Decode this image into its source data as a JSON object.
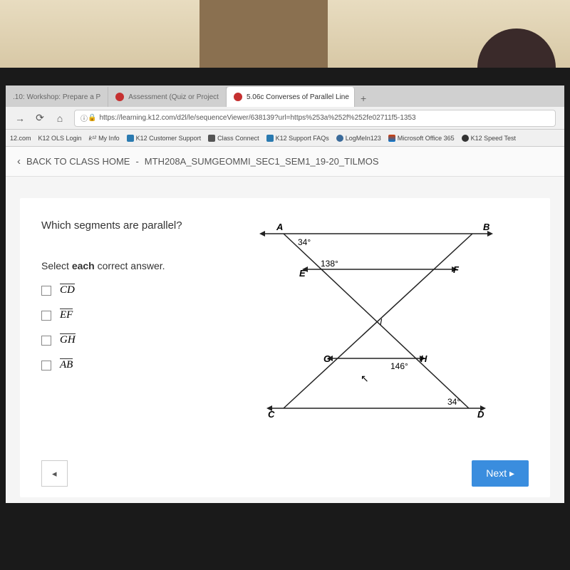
{
  "tabs": [
    {
      "label": ".10: Workshop: Prepare a P",
      "active": false
    },
    {
      "label": "Assessment (Quiz or Project",
      "active": false
    },
    {
      "label": "5.06c Converses of Parallel Line",
      "active": true
    }
  ],
  "url": "https://learning.k12.com/d2l/le/sequenceViewer/638139?url=https%253a%252f%252fe02711f5-1353",
  "bookmarks": [
    {
      "label": "12.com"
    },
    {
      "label": "K12 OLS Login"
    },
    {
      "label": "My Info"
    },
    {
      "label": "K12 Customer Support"
    },
    {
      "label": "Class Connect"
    },
    {
      "label": "K12 Support FAQs"
    },
    {
      "label": "LogMeIn123"
    },
    {
      "label": "Microsoft Office 365"
    },
    {
      "label": "K12 Speed Test"
    }
  ],
  "breadcrumb": {
    "back": "BACK TO CLASS HOME",
    "sep": "-",
    "course": "MTH208A_SUMGEOMMI_SEC1_SEM1_19-20_TILMOS"
  },
  "quiz": {
    "question": "Which segments are parallel?",
    "instruction_prefix": "Select ",
    "instruction_bold": "each",
    "instruction_suffix": " correct answer.",
    "answers": [
      {
        "label": "CD"
      },
      {
        "label": "EF"
      },
      {
        "label": "GH"
      },
      {
        "label": "AB"
      }
    ],
    "diagram": {
      "points": {
        "A": "A",
        "B": "B",
        "C": "C",
        "D": "D",
        "E": "E",
        "F": "F",
        "G": "G",
        "H": "H",
        "I": "I"
      },
      "angles": {
        "A": "34°",
        "E": "138°",
        "H": "146°",
        "D": "34°"
      }
    },
    "prev": "◂",
    "next": "Next ▸"
  }
}
